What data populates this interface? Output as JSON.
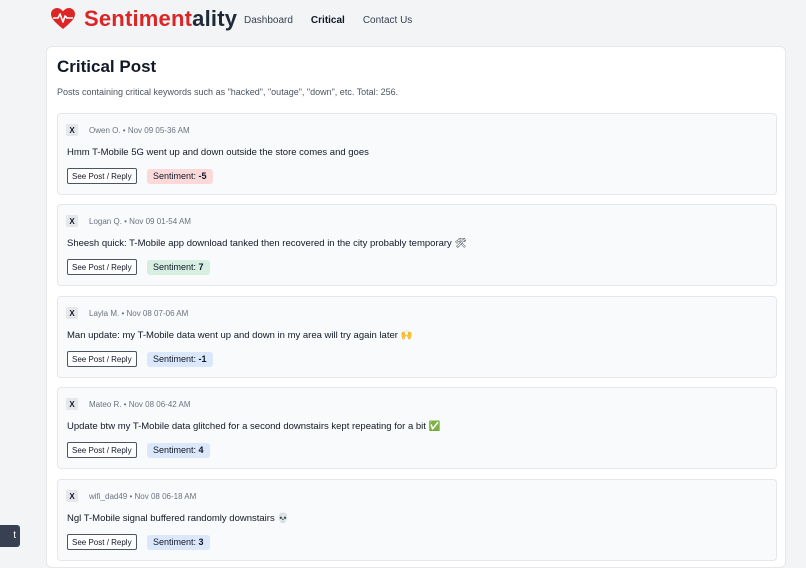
{
  "brand": {
    "name_part1": "Sentiment",
    "name_part2": "ality",
    "logo_color": "#dc2626"
  },
  "nav": {
    "items": [
      {
        "label": "Dashboard"
      },
      {
        "label": "Critical"
      },
      {
        "label": "Contact Us"
      }
    ],
    "active": "Critical"
  },
  "page": {
    "title": "Critical Post",
    "description": "Posts containing critical keywords such as \"hacked\", \"outage\", \"down\", etc. Total: 256."
  },
  "posts": [
    {
      "source": "X",
      "meta": "Owen O. • Nov 09 05-36 AM",
      "text": "Hmm T-Mobile 5G went up and down outside the store comes and goes",
      "button": "See Post / Reply",
      "sentiment_label": "Sentiment: ",
      "sentiment_value": "-5",
      "sentiment_color": "#fcd9d9"
    },
    {
      "source": "X",
      "meta": "Logan Q. • Nov 09 01-54 AM",
      "text": "Sheesh quick: T-Mobile app download tanked then recovered in the city probably temporary 🛠",
      "button": "See Post / Reply",
      "sentiment_label": "Sentiment: ",
      "sentiment_value": "7",
      "sentiment_color": "#d7efe0"
    },
    {
      "source": "X",
      "meta": "Layla M. • Nov 08 07-06 AM",
      "text": "Man update: my T-Mobile data went up and down in my area will try again later 🙌",
      "button": "See Post / Reply",
      "sentiment_label": "Sentiment: ",
      "sentiment_value": "-1",
      "sentiment_color": "#dbe7fb"
    },
    {
      "source": "X",
      "meta": "Mateo R. • Nov 08 06-42 AM",
      "text": "Update btw my T-Mobile data glitched for a second downstairs kept repeating for a bit ✅",
      "button": "See Post / Reply",
      "sentiment_label": "Sentiment: ",
      "sentiment_value": "4",
      "sentiment_color": "#dbe7fb"
    },
    {
      "source": "X",
      "meta": "wifi_dad49 • Nov 08 06-18 AM",
      "text": "Ngl T-Mobile signal buffered randomly downstairs 💀",
      "button": "See Post / Reply",
      "sentiment_label": "Sentiment: ",
      "sentiment_value": "3",
      "sentiment_color": "#dbe7fb"
    }
  ],
  "corner_tab": {
    "label": "t"
  }
}
